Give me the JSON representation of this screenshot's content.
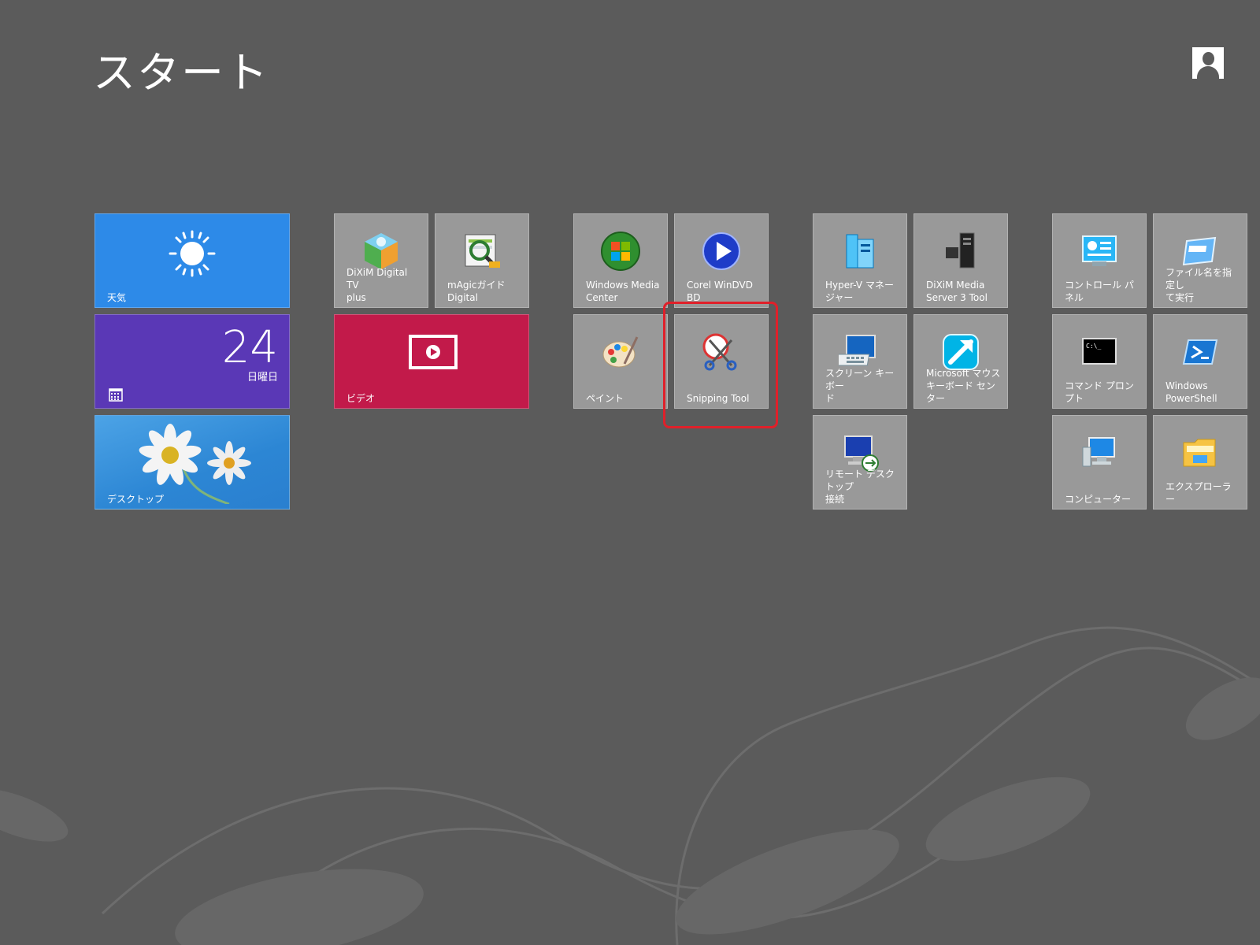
{
  "header": {
    "title": "スタート"
  },
  "colors": {
    "background": "#5b5b5b",
    "tile_gray": "#999999",
    "weather": "#2d8ae8",
    "calendar": "#5a38b6",
    "video": "#c21a4a",
    "highlight": "#e0202a"
  },
  "tiles": {
    "weather": {
      "label": "天気",
      "icon": "sun-icon"
    },
    "calendar": {
      "date": "24",
      "day": "日曜日",
      "icon": "calendar-icon"
    },
    "desktop": {
      "label": "デスクトップ",
      "icon": "daisy-image"
    },
    "dixim_tv": {
      "label": "DiXiM Digital TV\nplus",
      "icon": "dixim-cube-icon"
    },
    "magic_guide": {
      "label": "mAgicガイド\nDigital",
      "icon": "magnifier-guide-icon"
    },
    "video": {
      "label": "ビデオ",
      "icon": "video-play-icon"
    },
    "wmc": {
      "label": "Windows Media\nCenter",
      "icon": "windows-media-center-icon"
    },
    "corel": {
      "label": "Corel WinDVD\nBD",
      "icon": "winddvd-play-icon"
    },
    "paint": {
      "label": "ペイント",
      "icon": "paint-palette-icon"
    },
    "snipping": {
      "label": "Snipping Tool",
      "icon": "scissors-icon"
    },
    "hyperv": {
      "label": "Hyper-V マネー\nジャー",
      "icon": "server-icon"
    },
    "dixim_server": {
      "label": "DiXiM Media\nServer 3 Tool",
      "icon": "media-server-icon"
    },
    "screen_keyboard": {
      "label": "スクリーン キーボー\nド",
      "icon": "keyboard-icon"
    },
    "ms_mouse": {
      "label": "Microsoft マウス\nキーボード センター",
      "icon": "mouse-center-icon"
    },
    "remote_desktop": {
      "label": "リモート デスクトップ\n接続",
      "icon": "remote-desktop-icon"
    },
    "control_panel": {
      "label": "コントロール パネル",
      "icon": "control-panel-icon"
    },
    "run": {
      "label": "ファイル名を指定し\nて実行",
      "icon": "run-icon"
    },
    "cmd": {
      "label": "コマンド プロンプト",
      "icon": "command-prompt-icon",
      "prompt_text": "C:\\_"
    },
    "powershell": {
      "label": "Windows\nPowerShell",
      "icon": "powershell-icon"
    },
    "computer": {
      "label": "コンピューター",
      "icon": "computer-icon"
    },
    "explorer": {
      "label": "エクスプローラー",
      "icon": "folder-icon"
    }
  }
}
